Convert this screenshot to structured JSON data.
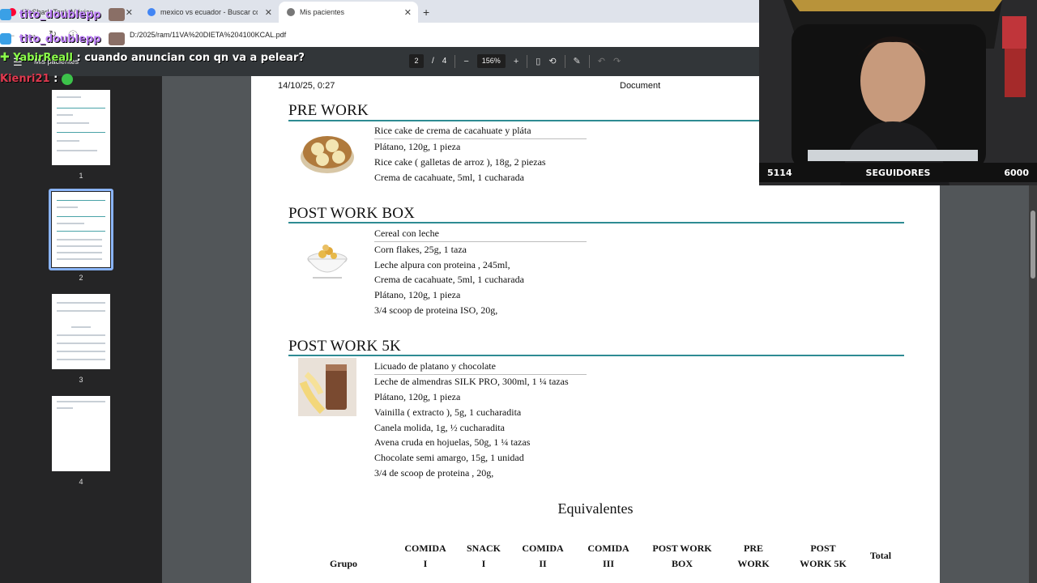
{
  "browser": {
    "tabs": [
      {
        "label": "(8) Shark Tank México...",
        "active": false,
        "favicon_color": "#ff0033"
      },
      {
        "label": "mexico vs ecuador - Buscar con...",
        "active": false,
        "favicon_color": "#4285f4"
      },
      {
        "label": "Mis pacientes",
        "active": true,
        "favicon_color": "#666666"
      }
    ],
    "url": "D:/2025/ram/11VA%20DIETA%204100KCAL.pdf"
  },
  "pdf_toolbar": {
    "title": "Mis pacientes",
    "current_page": "2",
    "page_separator": "/",
    "total_pages": "4",
    "zoom": "156%"
  },
  "sidebar": {
    "thumbnails": [
      {
        "page": "1",
        "selected": false
      },
      {
        "page": "2",
        "selected": true
      },
      {
        "page": "3",
        "selected": false
      },
      {
        "page": "4",
        "selected": false
      }
    ]
  },
  "document": {
    "header_date": "14/10/25, 0:27",
    "header_title": "Document",
    "sections": [
      {
        "title": "PRE WORK",
        "meal": "Rice cake de crema de cacahuate y pláta",
        "ingredients": [
          "Plátano, 120g, 1 pieza",
          "Rice cake ( galletas de arroz ), 18g, 2 piezas",
          "Crema de cacahuate, 5ml, 1 cucharada"
        ]
      },
      {
        "title": "POST WORK BOX",
        "meal": "Cereal con leche",
        "ingredients": [
          "Corn flakes, 25g, 1 taza",
          "Leche alpura con proteina , 245ml,",
          "Crema de cacahuate, 5ml, 1 cucharada",
          "Plátano, 120g, 1 pieza",
          "3/4 scoop de proteina ISO, 20g,"
        ]
      },
      {
        "title": "POST WORK 5K",
        "meal": "Licuado de platano y chocolate",
        "ingredients": [
          "Leche de almendras SILK PRO, 300ml, 1 ¼ tazas",
          "Plátano, 120g, 1 pieza",
          "Vainilla ( extracto ), 5g, 1 cucharadita",
          "Canela molida, 1g, ½ cucharadita",
          "Avena cruda en hojuelas, 50g, 1 ¼ tazas",
          "Chocolate semi amargo, 15g, 1 unidad",
          "3/4 de scoop de proteina , 20g,"
        ]
      }
    ],
    "equivalents_title": "Equivalentes",
    "table_headers": [
      [
        "Grupo"
      ],
      [
        "COMIDA",
        "I"
      ],
      [
        "SNACK",
        "I"
      ],
      [
        "COMIDA",
        "II"
      ],
      [
        "COMIDA",
        "III"
      ],
      [
        "POST WORK",
        "BOX"
      ],
      [
        "PRE",
        "WORK"
      ],
      [
        "POST",
        "WORK 5K"
      ],
      [
        "Total"
      ]
    ]
  },
  "chat": {
    "rows": [
      {
        "user": "tito_doublepp",
        "message": ""
      },
      {
        "user": "tito_doublepp",
        "message": ""
      },
      {
        "user": "YabirReall",
        "message": ": cuando anuncian con qn va a pelear?"
      },
      {
        "user": "Kienri21",
        "message": ":"
      }
    ]
  },
  "stream_overlay": {
    "followers_current": "5114",
    "followers_label": "SEGUIDORES",
    "followers_goal": "6000",
    "followers_progress": 0.852
  },
  "colors": {
    "accent_rule": "#2e8b93",
    "chat_name": "#b97cf2",
    "yabir_name": "#8bff4a",
    "kienri_name": "#e0394f"
  }
}
